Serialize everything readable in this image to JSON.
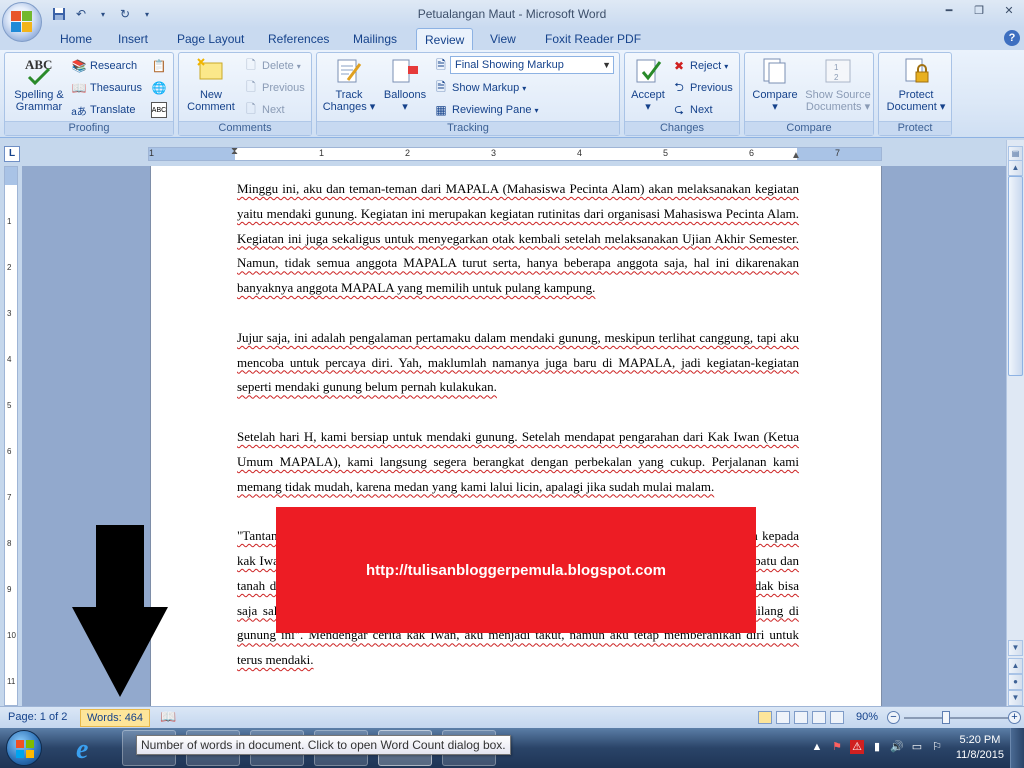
{
  "window": {
    "title": "Petualangan Maut - Microsoft Word"
  },
  "tabs": [
    "Home",
    "Insert",
    "Page Layout",
    "References",
    "Mailings",
    "Review",
    "View",
    "Foxit Reader PDF"
  ],
  "active_tab": "Review",
  "ribbon": {
    "proofing": {
      "label": "Proofing",
      "spelling": "Spelling &",
      "spelling2": "Grammar",
      "research": "Research",
      "thesaurus": "Thesaurus",
      "translate": "Translate"
    },
    "comments": {
      "label": "Comments",
      "new": "New",
      "new2": "Comment",
      "delete": "Delete",
      "previous": "Previous",
      "next": "Next"
    },
    "tracking": {
      "label": "Tracking",
      "track": "Track",
      "track2": "Changes",
      "balloons": "Balloons",
      "markup_select": "Final Showing Markup",
      "show_markup": "Show Markup",
      "reviewing_pane": "Reviewing Pane"
    },
    "changes": {
      "label": "Changes",
      "accept": "Accept",
      "reject": "Reject",
      "previous": "Previous",
      "next": "Next"
    },
    "compare": {
      "label": "Compare",
      "compare": "Compare",
      "show_source": "Show Source",
      "show_source2": "Documents"
    },
    "protect": {
      "label": "Protect",
      "protect": "Protect",
      "protect2": "Document"
    }
  },
  "ruler": {
    "numbers": [
      "1",
      "1",
      "2",
      "3",
      "4",
      "5",
      "6",
      "7"
    ],
    "vnumbers": [
      "1",
      "2",
      "3",
      "4",
      "5",
      "6",
      "7",
      "8",
      "9",
      "10",
      "11"
    ]
  },
  "document": {
    "paragraphs": [
      "Minggu ini, aku dan teman-teman dari MAPALA (Mahasiswa Pecinta Alam) akan melaksanakan kegiatan yaitu mendaki gunung. Kegiatan ini merupakan kegiatan rutinitas dari organisasi Mahasiswa Pecinta Alam. Kegiatan ini juga sekaligus untuk menyegarkan otak kembali setelah melaksanakan Ujian Akhir Semester. Namun, tidak semua anggota MAPALA turut serta, hanya beberapa anggota saja, hal ini dikarenakan banyaknya anggota MAPALA yang memilih untuk pulang kampung.",
      "Jujur saja, ini adalah pengalaman pertamaku dalam mendaki gunung, meskipun terlihat canggung, tapi aku mencoba untuk percaya diri. Yah, maklumlah namanya juga baru di MAPALA, jadi kegiatan-kegiatan seperti mendaki gunung belum pernah kulakukan.",
      "Setelah hari H, kami bersiap untuk mendaki gunung. Setelah mendapat pengarahan dari Kak Iwan (Ketua Umum MAPALA), kami langsung segera berangkat dengan perbekalan yang cukup. Perjalanan kami memang tidak mudah, karena medan yang kami lalui licin, apalagi jika sudah mulai malam.",
      "\"Tantangan yang akan kita hadapi sangat berat\", kata Kak Iwan kepada kami. Kami pun bertanya kepada kak Iwan, kenapa jalurnya licin sekali, kak? Kita harus berhati-hati dalam perjalanan, karena batu-batu dan tanah disini licin dikarenakan hujan semalam. Selain itu kita harus selalu bersama, karena jika tidak bisa saja salah satu dari kita akan tersesat dan hilang. Sudah banyak kejadian para pendaki yang hilang di gunung ini\". Mendengar cerita kak Iwan, aku menjadi takut, namun aku tetap memberanikan diri untuk terus mendaki."
    ]
  },
  "overlay": {
    "url": "http://tulisanbloggerpemula.blogspot.com"
  },
  "status": {
    "page": "Page: 1 of 2",
    "words": "Words: 464",
    "zoom": "90%"
  },
  "tooltip": "Number of words in document. Click to open Word Count dialog box.",
  "clock": {
    "time": "5:20 PM",
    "date": "11/8/2015"
  }
}
